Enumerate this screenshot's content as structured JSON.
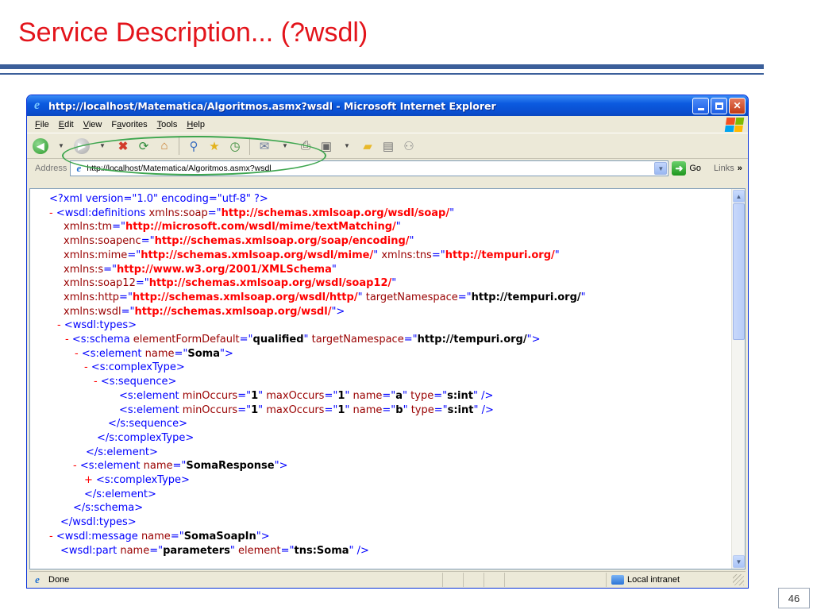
{
  "slide": {
    "title": "Service Description... (?wsdl)",
    "page_number": "46"
  },
  "browser": {
    "window_title": "http://localhost/Matematica/Algoritmos.asmx?wsdl - Microsoft Internet Explorer",
    "menu": [
      {
        "acc": "F",
        "rest": "ile"
      },
      {
        "acc": "E",
        "rest": "dit"
      },
      {
        "acc": "V",
        "rest": "iew"
      },
      {
        "pre": "F",
        "acc": "a",
        "rest": "vorites"
      },
      {
        "acc": "T",
        "rest": "ools"
      },
      {
        "acc": "H",
        "rest": "elp"
      }
    ],
    "address_label": "Address",
    "address_url": "http://localhost/Matematica/Algoritmos.asmx?wsdl",
    "go_label": "Go",
    "links_label": "Links",
    "links_chevron": "»",
    "status_text": "Done",
    "zone_text": "Local intranet"
  },
  "xml_lines": [
    [
      [
        "t",
        "<?xml version=\"1.0\" encoding=\"utf-8\" ?>"
      ]
    ],
    [
      [
        "m",
        "- "
      ],
      [
        "t",
        "<wsdl:definitions "
      ],
      [
        "a",
        "xmlns:soap"
      ],
      [
        "t",
        "=\""
      ],
      [
        "v",
        "http://schemas.xmlsoap.org/wsdl/soap/"
      ],
      [
        "t",
        "\""
      ]
    ],
    [
      [
        "a",
        "xmlns:tm"
      ],
      [
        "t",
        "=\""
      ],
      [
        "v",
        "http://microsoft.com/wsdl/mime/textMatching/"
      ],
      [
        "t",
        "\""
      ]
    ],
    [
      [
        "a",
        "xmlns:soapenc"
      ],
      [
        "t",
        "=\""
      ],
      [
        "v",
        "http://schemas.xmlsoap.org/soap/encoding/"
      ],
      [
        "t",
        "\""
      ]
    ],
    [
      [
        "a",
        "xmlns:mime"
      ],
      [
        "t",
        "=\""
      ],
      [
        "v",
        "http://schemas.xmlsoap.org/wsdl/mime/"
      ],
      [
        "t",
        "\" "
      ],
      [
        "a",
        "xmlns:tns"
      ],
      [
        "t",
        "=\""
      ],
      [
        "v",
        "http://tempuri.org/"
      ],
      [
        "t",
        "\""
      ]
    ],
    [
      [
        "a",
        "xmlns:s"
      ],
      [
        "t",
        "=\""
      ],
      [
        "v",
        "http://www.w3.org/2001/XMLSchema"
      ],
      [
        "t",
        "\""
      ]
    ],
    [
      [
        "a",
        "xmlns:soap12"
      ],
      [
        "t",
        "=\""
      ],
      [
        "v",
        "http://schemas.xmlsoap.org/wsdl/soap12/"
      ],
      [
        "t",
        "\""
      ]
    ],
    [
      [
        "a",
        "xmlns:http"
      ],
      [
        "t",
        "=\""
      ],
      [
        "v",
        "http://schemas.xmlsoap.org/wsdl/http/"
      ],
      [
        "t",
        "\" "
      ],
      [
        "a",
        "targetNamespace"
      ],
      [
        "t",
        "=\""
      ],
      [
        "b",
        "http://tempuri.org/"
      ],
      [
        "t",
        "\""
      ]
    ],
    [
      [
        "a",
        "xmlns:wsdl"
      ],
      [
        "t",
        "=\""
      ],
      [
        "v",
        "http://schemas.xmlsoap.org/wsdl/"
      ],
      [
        "t",
        "\">"
      ]
    ],
    [
      [
        "m",
        "- "
      ],
      [
        "t",
        "<wsdl:types>"
      ]
    ],
    [
      [
        "m",
        "- "
      ],
      [
        "t",
        "<s:schema "
      ],
      [
        "a",
        "elementFormDefault"
      ],
      [
        "t",
        "=\""
      ],
      [
        "b",
        "qualified"
      ],
      [
        "t",
        "\" "
      ],
      [
        "a",
        "targetNamespace"
      ],
      [
        "t",
        "=\""
      ],
      [
        "b",
        "http://tempuri.org/"
      ],
      [
        "t",
        "\">"
      ]
    ],
    [
      [
        "m",
        "- "
      ],
      [
        "t",
        "<s:element "
      ],
      [
        "a",
        "name"
      ],
      [
        "t",
        "=\""
      ],
      [
        "b",
        "Soma"
      ],
      [
        "t",
        "\">"
      ]
    ],
    [
      [
        "m",
        "- "
      ],
      [
        "t",
        "<s:complexType>"
      ]
    ],
    [
      [
        "m",
        "- "
      ],
      [
        "t",
        "<s:sequence>"
      ]
    ],
    [
      [
        "t",
        "<s:element "
      ],
      [
        "a",
        "minOccurs"
      ],
      [
        "t",
        "=\""
      ],
      [
        "b",
        "1"
      ],
      [
        "t",
        "\" "
      ],
      [
        "a",
        "maxOccurs"
      ],
      [
        "t",
        "=\""
      ],
      [
        "b",
        "1"
      ],
      [
        "t",
        "\" "
      ],
      [
        "a",
        "name"
      ],
      [
        "t",
        "=\""
      ],
      [
        "b",
        "a"
      ],
      [
        "t",
        "\" "
      ],
      [
        "a",
        "type"
      ],
      [
        "t",
        "=\""
      ],
      [
        "b",
        "s:int"
      ],
      [
        "t",
        "\" />"
      ]
    ],
    [
      [
        "t",
        "<s:element "
      ],
      [
        "a",
        "minOccurs"
      ],
      [
        "t",
        "=\""
      ],
      [
        "b",
        "1"
      ],
      [
        "t",
        "\" "
      ],
      [
        "a",
        "maxOccurs"
      ],
      [
        "t",
        "=\""
      ],
      [
        "b",
        "1"
      ],
      [
        "t",
        "\" "
      ],
      [
        "a",
        "name"
      ],
      [
        "t",
        "=\""
      ],
      [
        "b",
        "b"
      ],
      [
        "t",
        "\" "
      ],
      [
        "a",
        "type"
      ],
      [
        "t",
        "=\""
      ],
      [
        "b",
        "s:int"
      ],
      [
        "t",
        "\" />"
      ]
    ],
    [
      [
        "t",
        "</s:sequence>"
      ]
    ],
    [
      [
        "t",
        "</s:complexType>"
      ]
    ],
    [
      [
        "t",
        "</s:element>"
      ]
    ],
    [
      [
        "m",
        "- "
      ],
      [
        "t",
        "<s:element "
      ],
      [
        "a",
        "name"
      ],
      [
        "t",
        "=\""
      ],
      [
        "b",
        "SomaResponse"
      ],
      [
        "t",
        "\">"
      ]
    ],
    [
      [
        "m",
        "+ "
      ],
      [
        "t",
        "<s:complexType>"
      ]
    ],
    [
      [
        "t",
        "</s:element>"
      ]
    ],
    [
      [
        "t",
        "</s:schema>"
      ]
    ],
    [
      [
        "t",
        "</wsdl:types>"
      ]
    ],
    [
      [
        "m",
        "- "
      ],
      [
        "t",
        "<wsdl:message "
      ],
      [
        "a",
        "name"
      ],
      [
        "t",
        "=\""
      ],
      [
        "b",
        "SomaSoapIn"
      ],
      [
        "t",
        "\">"
      ]
    ],
    [
      [
        "t",
        "<wsdl:part "
      ],
      [
        "a",
        "name"
      ],
      [
        "t",
        "=\""
      ],
      [
        "b",
        "parameters"
      ],
      [
        "t",
        "\" "
      ],
      [
        "a",
        "element"
      ],
      [
        "t",
        "=\""
      ],
      [
        "b",
        "tns:Soma"
      ],
      [
        "t",
        "\" />"
      ]
    ]
  ],
  "icons": {
    "title_icon": "ie-logo-icon",
    "back": "back-arrow-icon",
    "forward": "forward-arrow-icon",
    "stop": "stop-icon",
    "refresh": "refresh-icon",
    "home": "home-icon",
    "search": "search-icon",
    "favorites": "favorites-star-icon",
    "history": "history-icon",
    "mail": "mail-icon",
    "print": "print-icon",
    "edit": "edit-icon",
    "discuss": "discuss-icon",
    "research": "research-icon",
    "messenger": "messenger-icon"
  },
  "colors": {
    "title_red": "#e3141b",
    "rule_blue": "#3b5f9a",
    "xml_tag": "#0000ff",
    "xml_attr": "#990000",
    "xml_value": "#ff0000",
    "highlight_oval": "#3ea64f"
  }
}
